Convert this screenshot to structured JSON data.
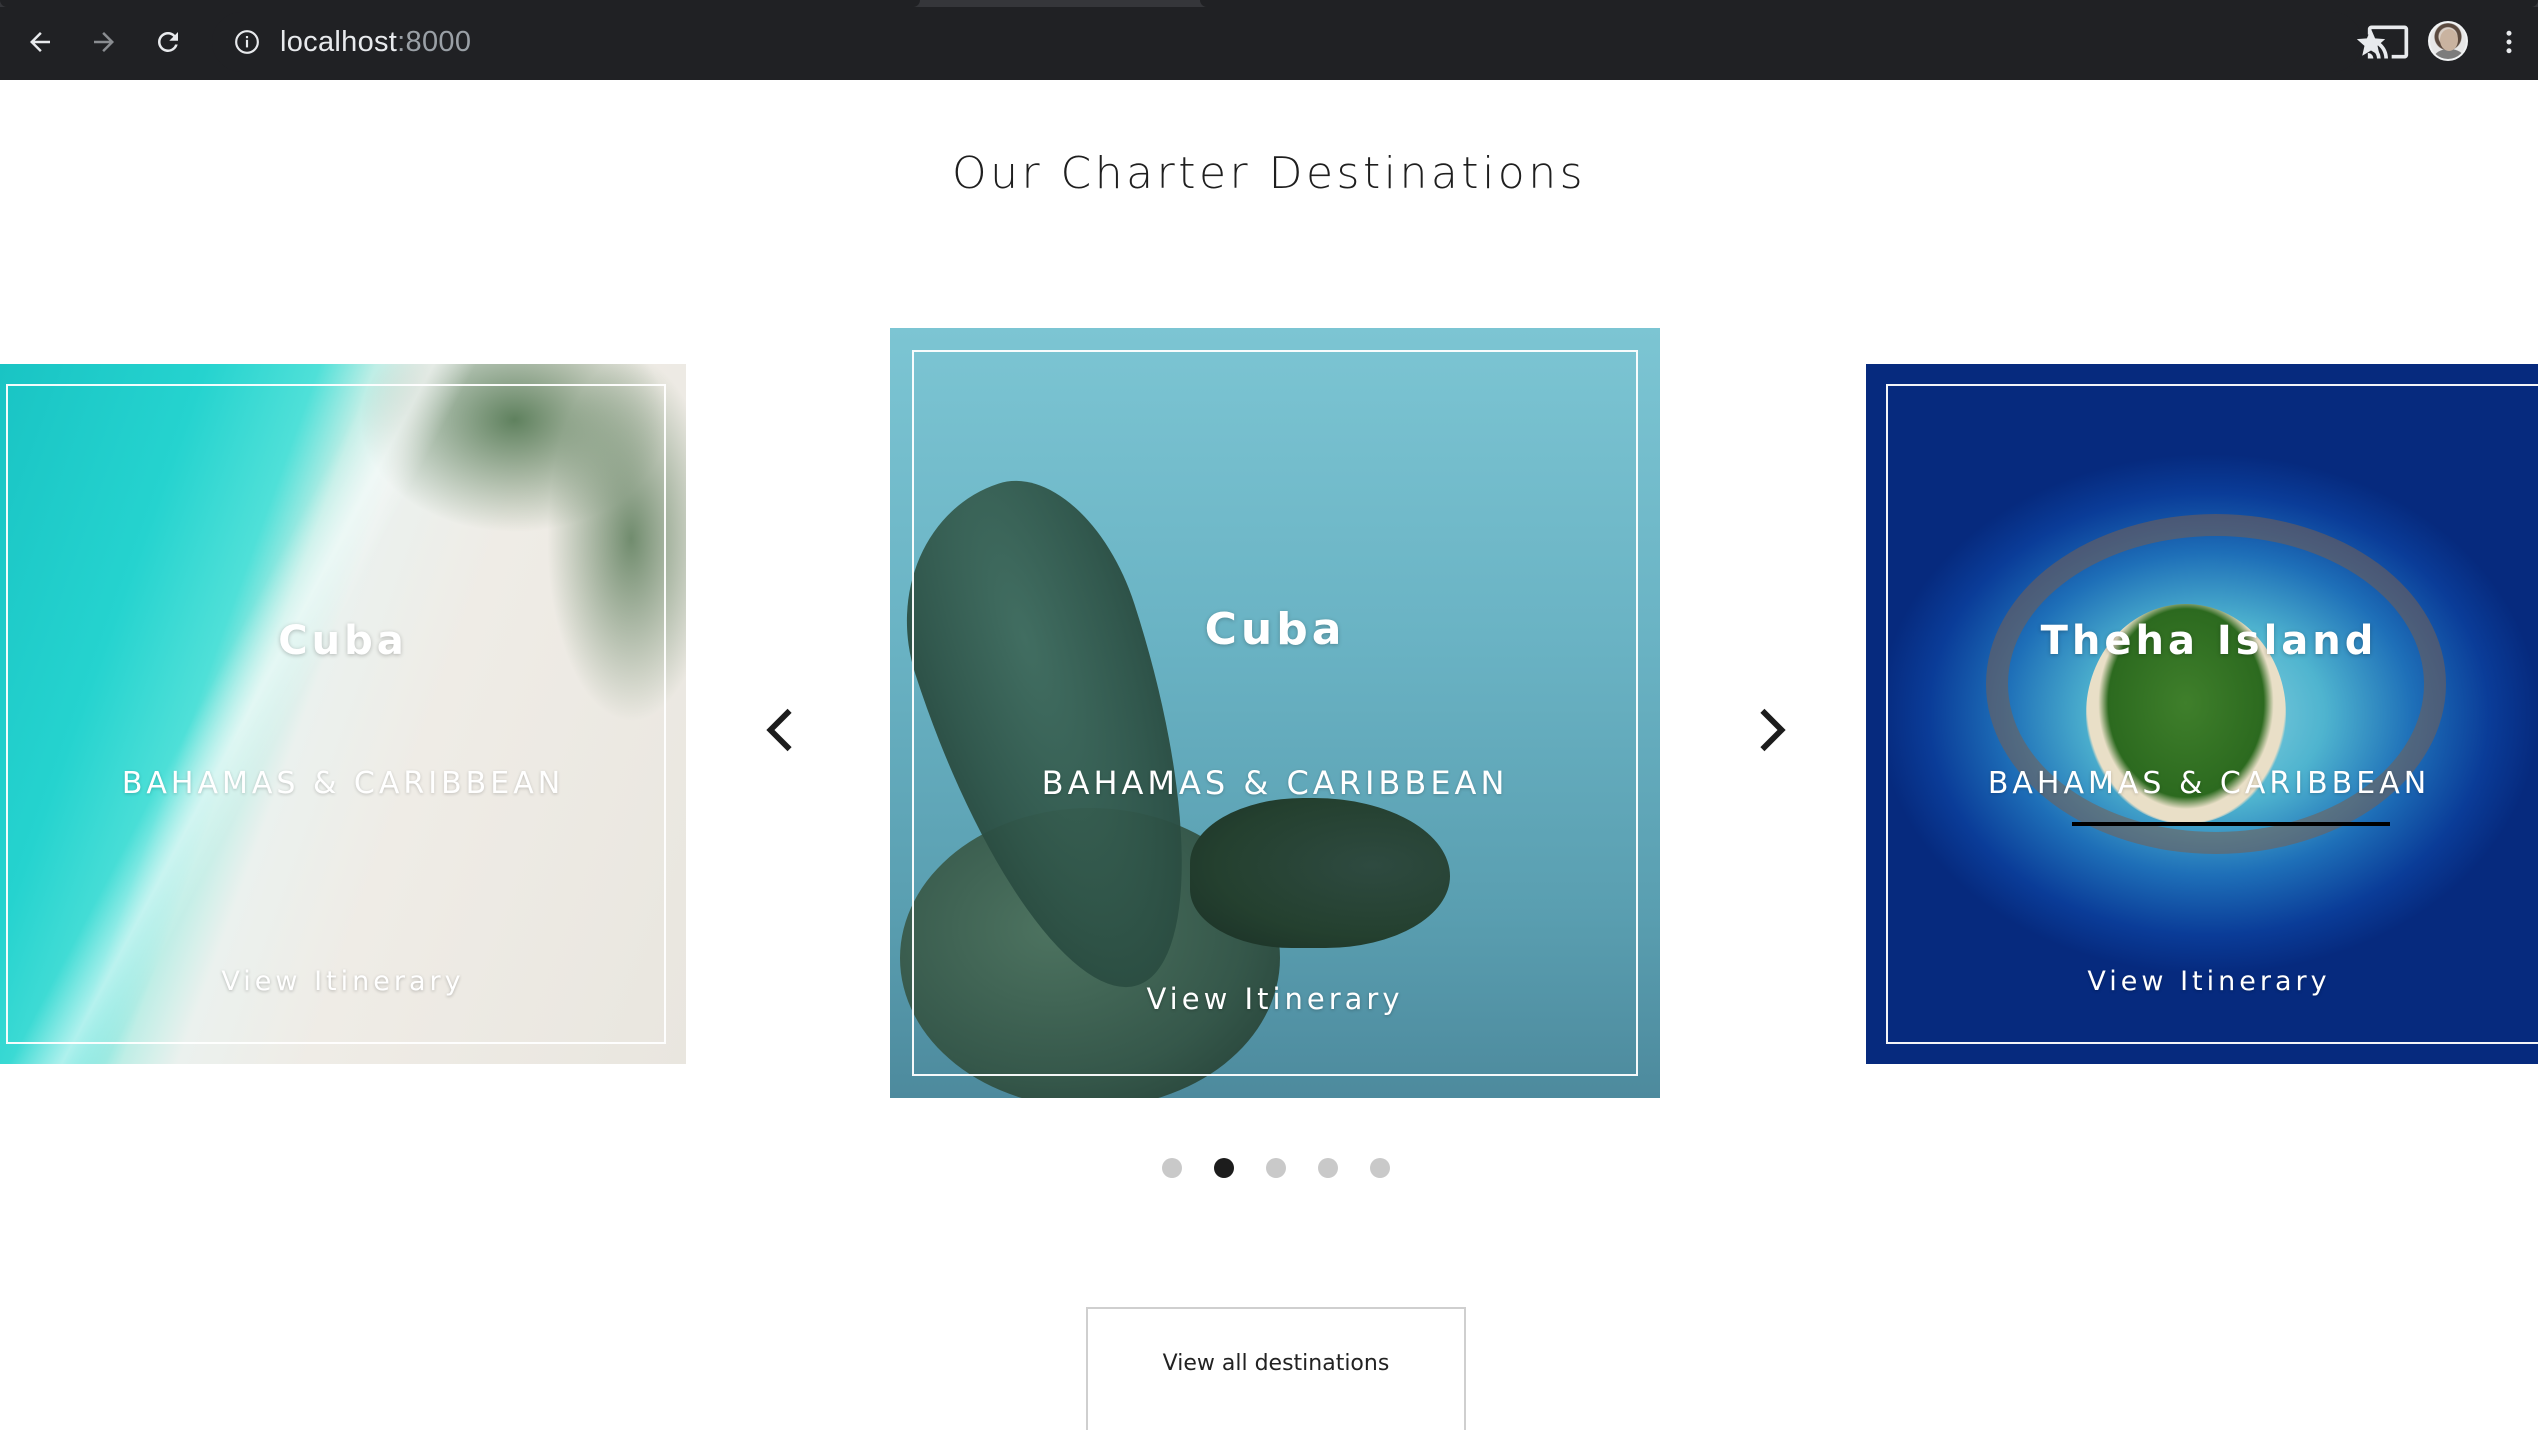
{
  "browser": {
    "url_host": "localhost",
    "url_port": ":8000"
  },
  "page": {
    "title": "Our Charter Destinations"
  },
  "carousel": {
    "cards": [
      {
        "city": "Cuba",
        "region": "BAHAMAS & CARIBBEAN",
        "link": "View Itinerary",
        "image": "aerial-beach-image"
      },
      {
        "city": "Cuba",
        "region": "BAHAMAS & CARIBBEAN",
        "link": "View Itinerary",
        "image": "sea-turtle-image"
      },
      {
        "city": "Theha Island",
        "region": "BAHAMAS & CARIBBEAN",
        "link": "View Itinerary",
        "image": "island-resort-image"
      }
    ],
    "active_index": 1,
    "dot_count": 5,
    "prev_icon": "chevron-left-icon",
    "next_icon": "chevron-right-icon"
  },
  "cta": {
    "view_all_label": "View all destinations"
  },
  "colors": {
    "browser_chrome": "#202124",
    "active_dot": "#1c1c1c",
    "inactive_dot": "#c9c9c9",
    "text": "#1f1f1f"
  }
}
